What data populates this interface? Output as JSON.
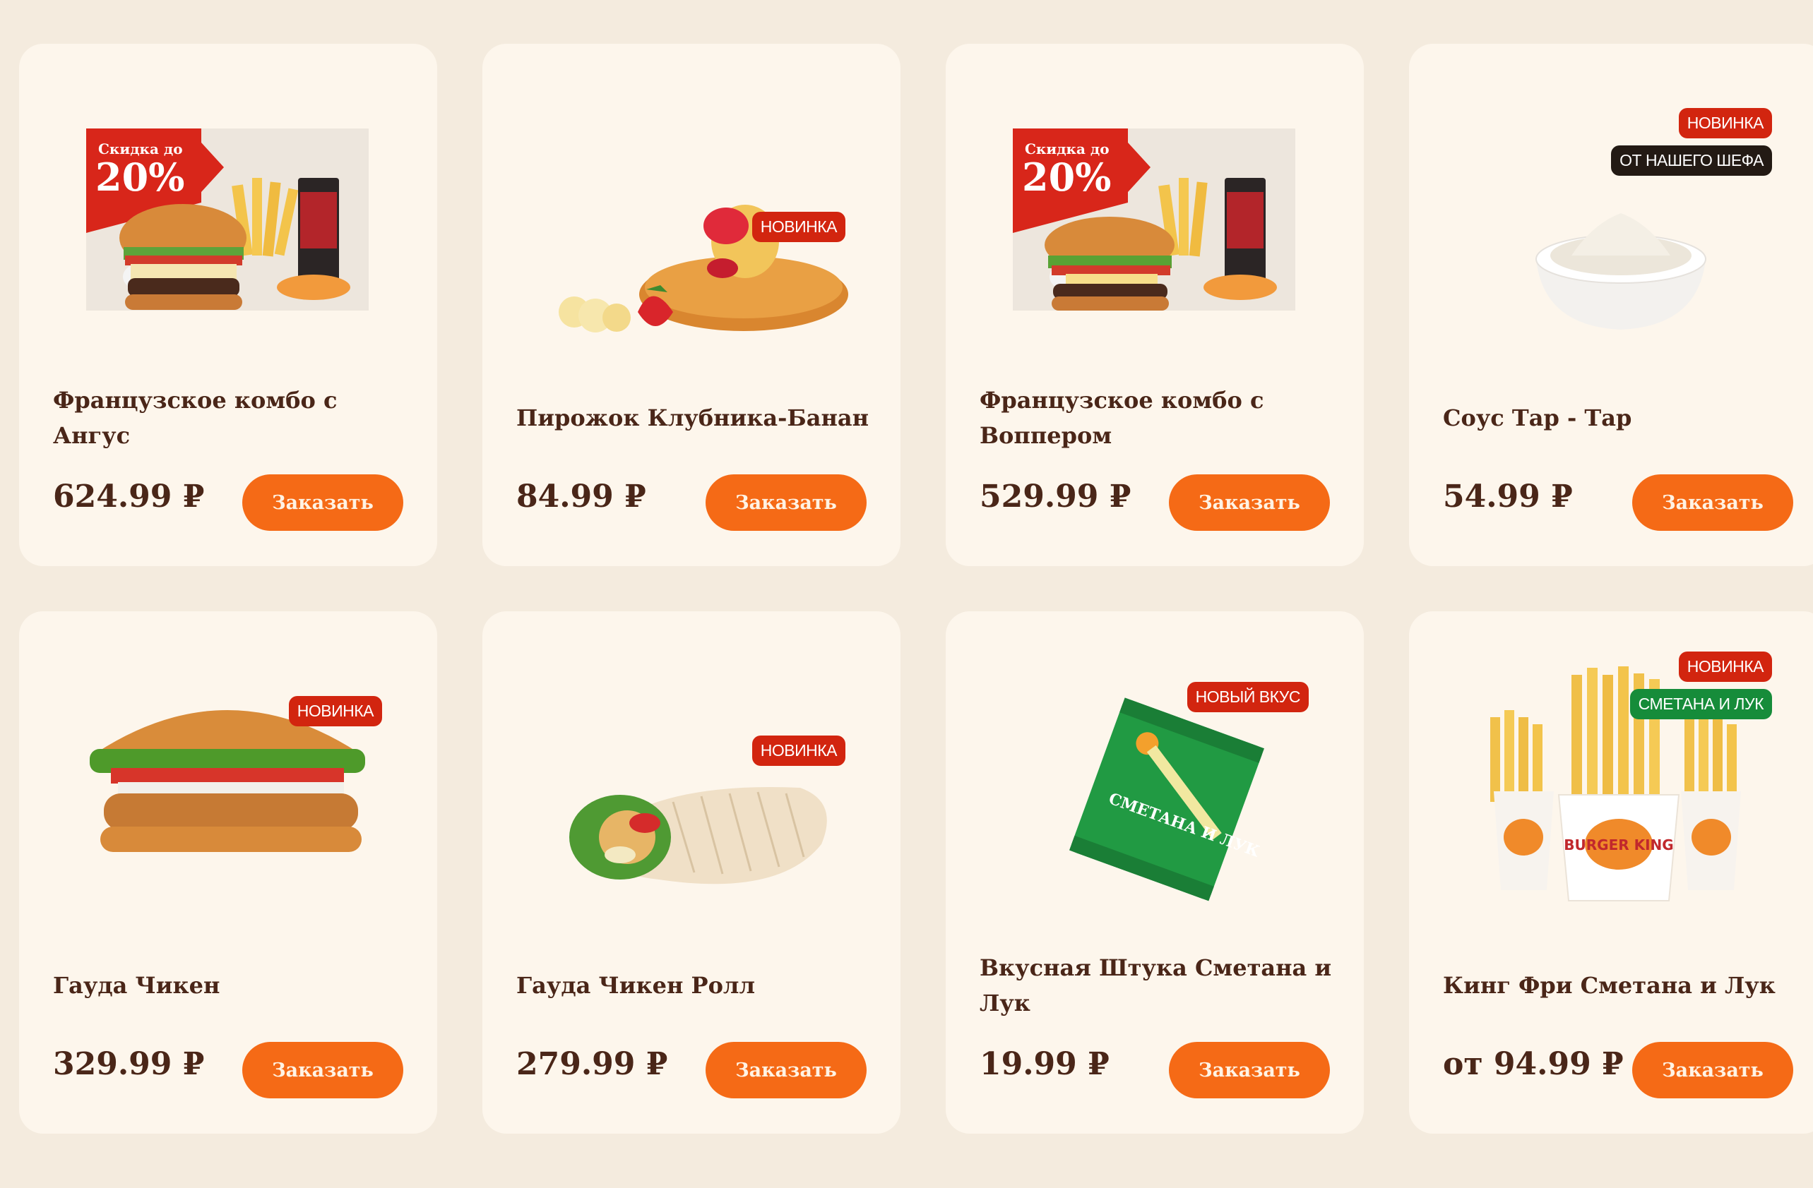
{
  "currency": "₽",
  "order_label": "Заказать",
  "promo": {
    "line1": "Скидка до",
    "value": "20%"
  },
  "cards": [
    {
      "name": "Французское комбо с Ангус",
      "price": "624.99 ₽",
      "badges": [],
      "promo": true
    },
    {
      "name": "Пирожок Клубника-Банан",
      "price": "84.99 ₽",
      "badges": [
        "НОВИНКА"
      ]
    },
    {
      "name": "Французское комбо с Воппером",
      "price": "529.99 ₽",
      "badges": [],
      "promo": true
    },
    {
      "name": "Соус Тар - Тар",
      "price": "54.99 ₽",
      "badges": [
        "НОВИНКА",
        "ОТ НАШЕГО ШЕФА"
      ]
    },
    {
      "name": "Гауда Чикен",
      "price": "329.99 ₽",
      "badges": [
        "НОВИНКА"
      ]
    },
    {
      "name": "Гауда Чикен Ролл",
      "price": "279.99 ₽",
      "badges": [
        "НОВИНКА"
      ]
    },
    {
      "name": "Вкусная Штука Сметана и Лук",
      "price": "19.99 ₽",
      "badges": [
        "НОВЫЙ ВКУС"
      ],
      "pack_text": "СМЕТАНА И ЛУК"
    },
    {
      "name": "Кинг Фри Сметана и Лук",
      "price": "от 94.99 ₽",
      "badges": [
        "НОВИНКА",
        "СМЕТАНА И ЛУК"
      ],
      "box_brand": "BURGER KING"
    }
  ],
  "colors": {
    "page_bg": "#f4ebde",
    "card_bg": "#fdf6ec",
    "button": "#f56a16",
    "text": "#4a2618",
    "badge_red": "#d2250f",
    "badge_dark": "#231a14",
    "badge_green": "#168c3a"
  }
}
